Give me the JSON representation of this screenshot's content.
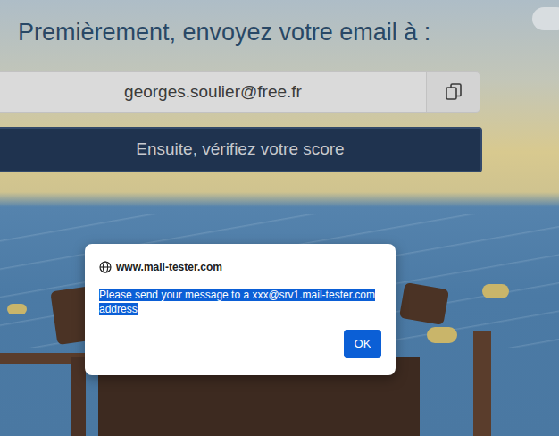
{
  "page": {
    "heading": "Premièrement, envoyez votre email à :",
    "email": "georges.soulier@free.fr",
    "check_button": "Ensuite, vérifiez votre score"
  },
  "dialog": {
    "origin": "www.mail-tester.com",
    "message": "Please send your message to a xxx@srv1.mail-tester.com address",
    "message_selected": true,
    "buttons": [
      "OK"
    ]
  }
}
